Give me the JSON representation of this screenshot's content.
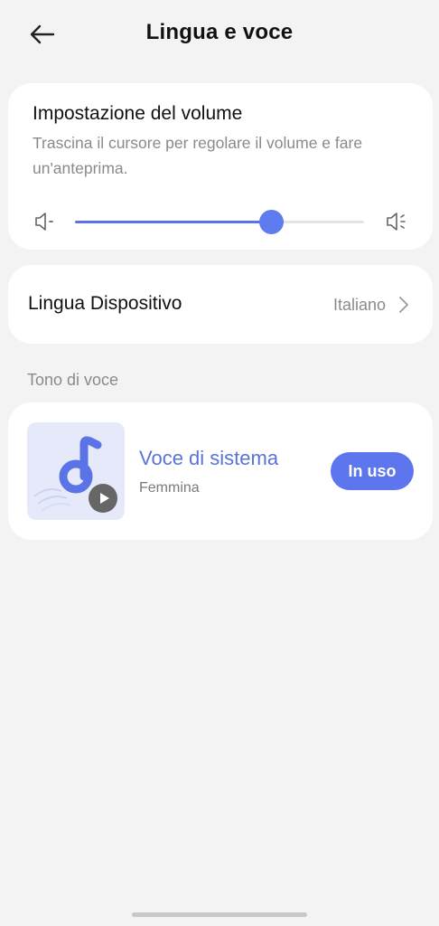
{
  "header": {
    "title": "Lingua e voce",
    "back_icon": "arrow-left-icon"
  },
  "volume": {
    "title": "Impostazione del volume",
    "description": "Trascina il cursore per regolare il volume e fare un'anteprima.",
    "level_fraction": 0.68,
    "low_icon": "volume-low-icon",
    "high_icon": "volume-high-icon"
  },
  "device_language": {
    "label": "Lingua Dispositivo",
    "value": "Italiano",
    "chevron_icon": "chevron-right-icon"
  },
  "voice_tone": {
    "section_label": "Tono di voce",
    "voice": {
      "name": "Voce di sistema",
      "gender": "Femmina",
      "status_button": "In uso",
      "thumbnail_icon": "music-note-icon",
      "play_icon": "play-icon"
    }
  },
  "colors": {
    "accent": "#5d76ee",
    "accent_text": "#5a73d8",
    "thumb_bg": "#e5e9fa",
    "background": "#f3f3f3",
    "card": "#ffffff"
  }
}
